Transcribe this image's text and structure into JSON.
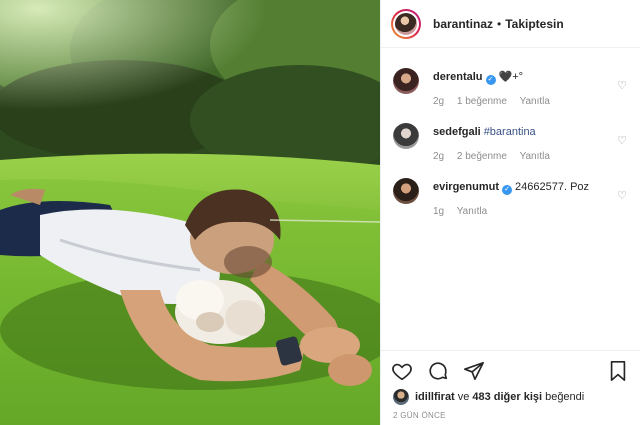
{
  "post": {
    "username": "barantinaz",
    "separator": "•",
    "follow_status": "Takiptesin"
  },
  "comments": [
    {
      "username": "derentalu",
      "verified": true,
      "text": "🖤+°",
      "time": "2g",
      "likes": "1 beğenme",
      "reply": "Yanıtla"
    },
    {
      "username": "sedefgali",
      "verified": false,
      "text": "#barantina",
      "time": "2g",
      "likes": "2 beğenme",
      "reply": "Yanıtla"
    },
    {
      "username": "evirgenumut",
      "verified": true,
      "text": "24662577. Poz",
      "time": "1g",
      "likes": "",
      "reply": "Yanıtla"
    }
  ],
  "likes": {
    "user": "idillfirat",
    "connector": "ve",
    "others": "483 diğer kişi",
    "suffix": "beğendi"
  },
  "date": "2 GÜN ÖNCE",
  "icons": {
    "heart": "heart-icon",
    "comment": "comment-icon",
    "share": "share-icon",
    "bookmark": "bookmark-icon"
  },
  "colors": {
    "verified": "#3897f0",
    "hashtag": "#385185",
    "muted": "#8e8e8e"
  }
}
